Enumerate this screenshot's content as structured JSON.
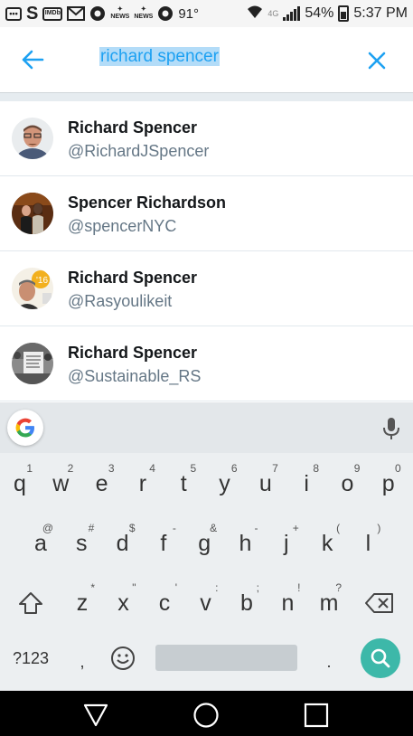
{
  "status_bar": {
    "temperature": "91°",
    "network": "4G",
    "battery": "54%",
    "time": "5:37 PM",
    "left_icons": [
      "message-icon",
      "s-app-icon",
      "imdb-icon",
      "gmail-icon",
      "chrome-icon",
      "news-icon",
      "news-icon",
      "chrome-icon"
    ],
    "imdb_label": "IMDb",
    "news_label": "NEWS"
  },
  "search": {
    "query": "richard spencer",
    "back_icon": "arrow-left-icon",
    "clear_icon": "close-icon",
    "accent_color": "#1da1f2"
  },
  "results": [
    {
      "name": "Richard Spencer",
      "handle": "@RichardJSpencer",
      "avatar": "portrait-with-glasses"
    },
    {
      "name": "Spencer Richardson",
      "handle": "@spencerNYC",
      "avatar": "couple-photo"
    },
    {
      "name": "Richard Spencer",
      "handle": "@Rasyoulikeit",
      "avatar": "man-with-orange-logo"
    },
    {
      "name": "Richard Spencer",
      "handle": "@Sustainable_RS",
      "avatar": "black-and-white-protest-photo"
    }
  ],
  "keyboard": {
    "row1": [
      {
        "k": "q",
        "h": "1"
      },
      {
        "k": "w",
        "h": "2"
      },
      {
        "k": "e",
        "h": "3"
      },
      {
        "k": "r",
        "h": "4"
      },
      {
        "k": "t",
        "h": "5"
      },
      {
        "k": "y",
        "h": "6"
      },
      {
        "k": "u",
        "h": "7"
      },
      {
        "k": "i",
        "h": "8"
      },
      {
        "k": "o",
        "h": "9"
      },
      {
        "k": "p",
        "h": "0"
      }
    ],
    "row2": [
      {
        "k": "a",
        "h": "@"
      },
      {
        "k": "s",
        "h": "#"
      },
      {
        "k": "d",
        "h": "$"
      },
      {
        "k": "f",
        "h": "-"
      },
      {
        "k": "g",
        "h": "&"
      },
      {
        "k": "h",
        "h": "-"
      },
      {
        "k": "j",
        "h": "+"
      },
      {
        "k": "k",
        "h": "("
      },
      {
        "k": "l",
        "h": ")"
      }
    ],
    "row3": [
      {
        "k": "z",
        "h": "*"
      },
      {
        "k": "x",
        "h": "\""
      },
      {
        "k": "c",
        "h": "'"
      },
      {
        "k": "v",
        "h": ":"
      },
      {
        "k": "b",
        "h": ";"
      },
      {
        "k": "n",
        "h": "!"
      },
      {
        "k": "m",
        "h": "?"
      }
    ],
    "symbols_label": "?123",
    "comma": ",",
    "period": ".",
    "search_color": "#3db8a9"
  },
  "nav_bar": {
    "buttons": [
      "back-triangle-icon",
      "home-circle-icon",
      "recents-square-icon"
    ]
  }
}
